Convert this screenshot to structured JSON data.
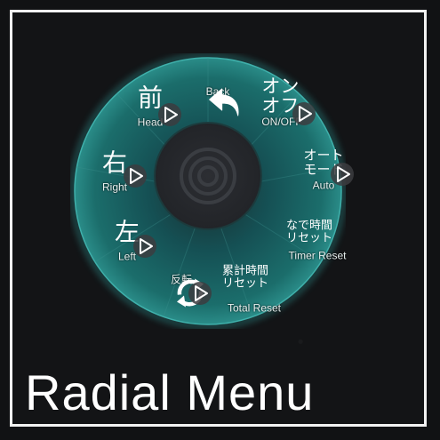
{
  "title": "Radial Menu",
  "menu": {
    "center_icon": "concentric-circles-icon",
    "items": [
      {
        "id": "back",
        "icon": "back-arrow-icon",
        "en": "Back"
      },
      {
        "id": "onoff",
        "jp": "オン\nオフ",
        "en": "ON/OFF"
      },
      {
        "id": "auto",
        "jp": "オート\nモード",
        "en": "Auto"
      },
      {
        "id": "timer-reset",
        "jp": "なで時間\nリセット",
        "en": "Timer Reset"
      },
      {
        "id": "total-reset",
        "jp": "累計時間\nリセット",
        "en": "Total Reset"
      },
      {
        "id": "reverse",
        "icon": "rotate-arrows-icon",
        "jp": "反転"
      },
      {
        "id": "left",
        "jp": "左",
        "en": "Left"
      },
      {
        "id": "right",
        "jp": "右",
        "en": "Right"
      },
      {
        "id": "head",
        "jp": "前",
        "en": "Head"
      }
    ]
  },
  "colors": {
    "teal": "#1d6b6a",
    "teal_dark": "#123d40",
    "glow": "#2fa3a0",
    "inner": "#2a2c30"
  }
}
